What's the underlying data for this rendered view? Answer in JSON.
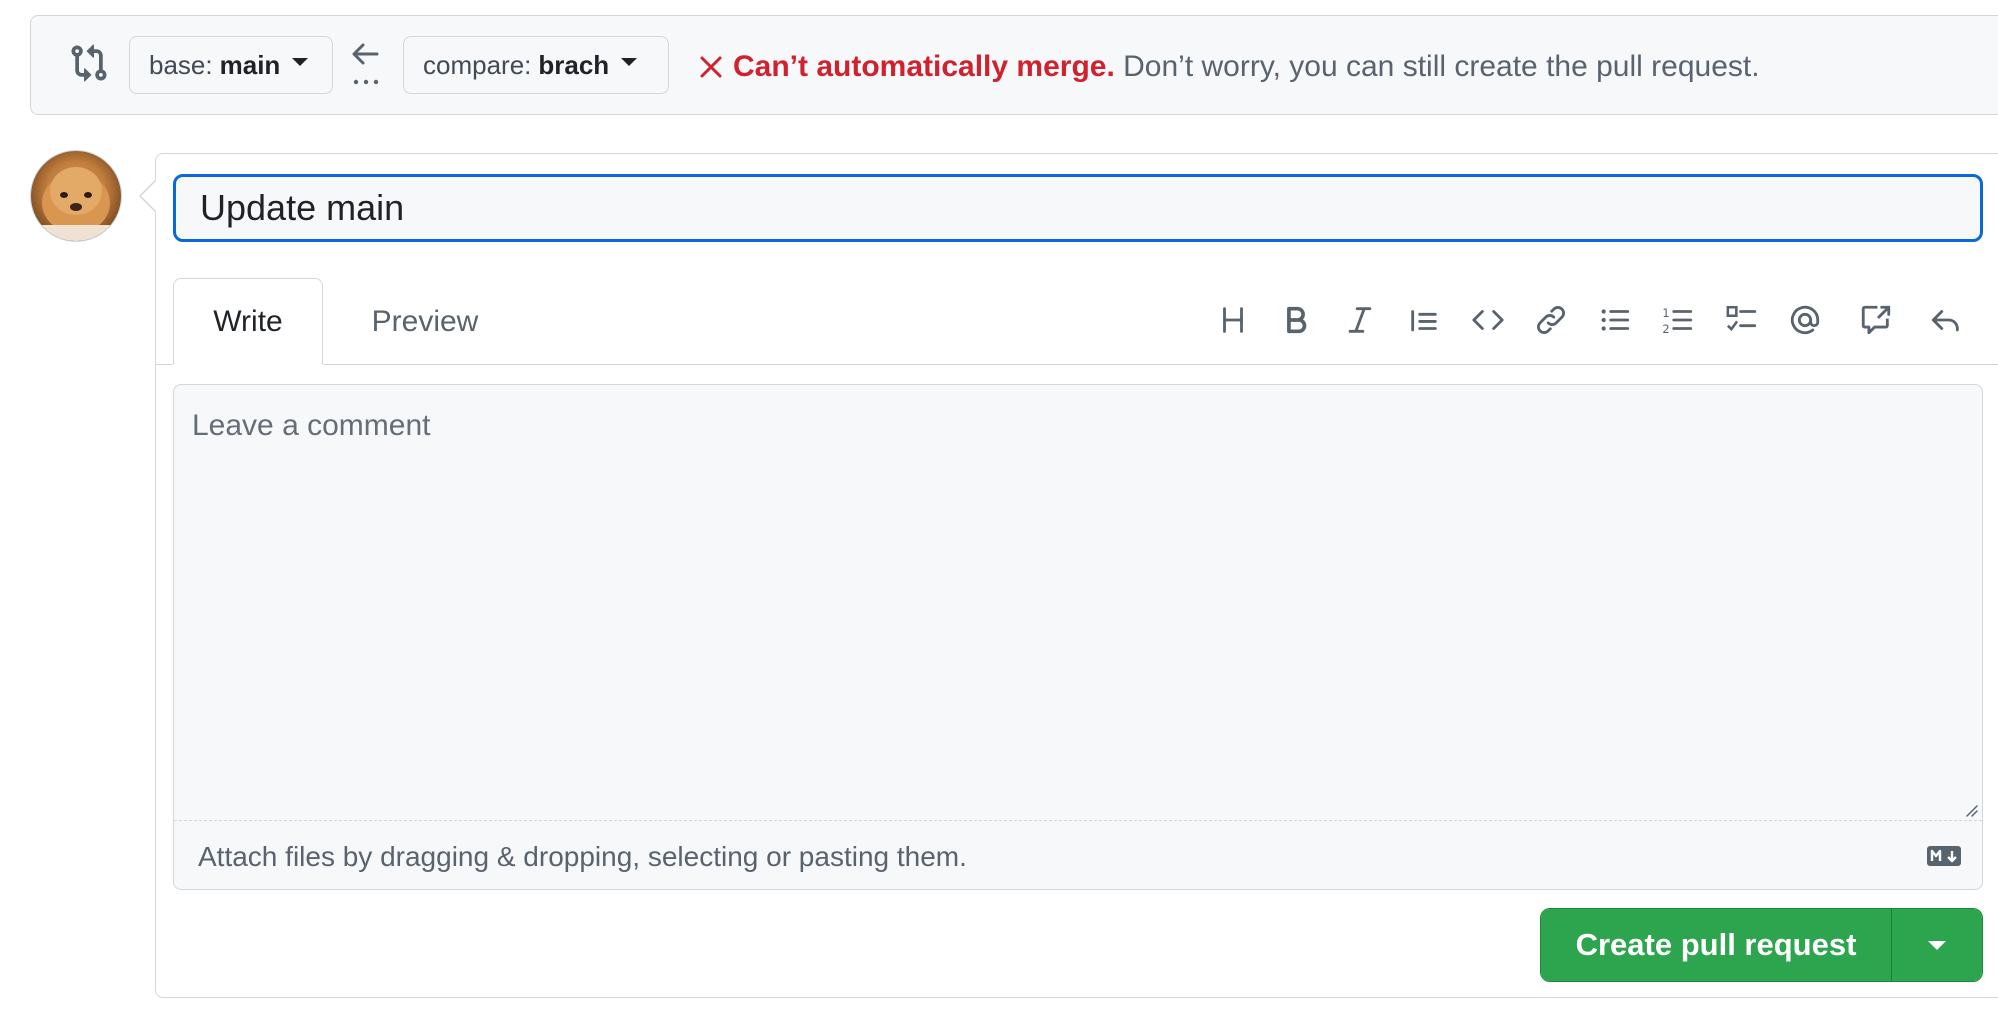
{
  "compare_bar": {
    "base_prefix": "base:",
    "base_branch": "main",
    "compare_prefix": "compare:",
    "compare_branch": "brach",
    "merge_status_title": "Can’t automatically merge.",
    "merge_status_desc": "Don’t worry, you can still create the pull request.",
    "icons": [
      "git-compare-icon",
      "arrow-left-icon",
      "ellipsis-icon",
      "x-icon"
    ]
  },
  "form": {
    "title_value": "Update main",
    "tabs": [
      {
        "label": "Write",
        "active": true
      },
      {
        "label": "Preview",
        "active": false
      }
    ],
    "toolbar": [
      "heading-icon",
      "bold-icon",
      "italic-icon",
      "quote-icon",
      "code-icon",
      "link-icon",
      "unordered-list-icon",
      "ordered-list-icon",
      "task-list-icon",
      "mention-icon",
      "reference-icon",
      "reply-icon"
    ],
    "comment_placeholder": "Leave a comment",
    "attach_text": "Attach files by dragging & dropping, selecting or pasting them.",
    "create_button_label": "Create pull request"
  },
  "colors": {
    "error": "#cf222e",
    "focus": "#0969da",
    "primary_button": "#2da44e"
  }
}
